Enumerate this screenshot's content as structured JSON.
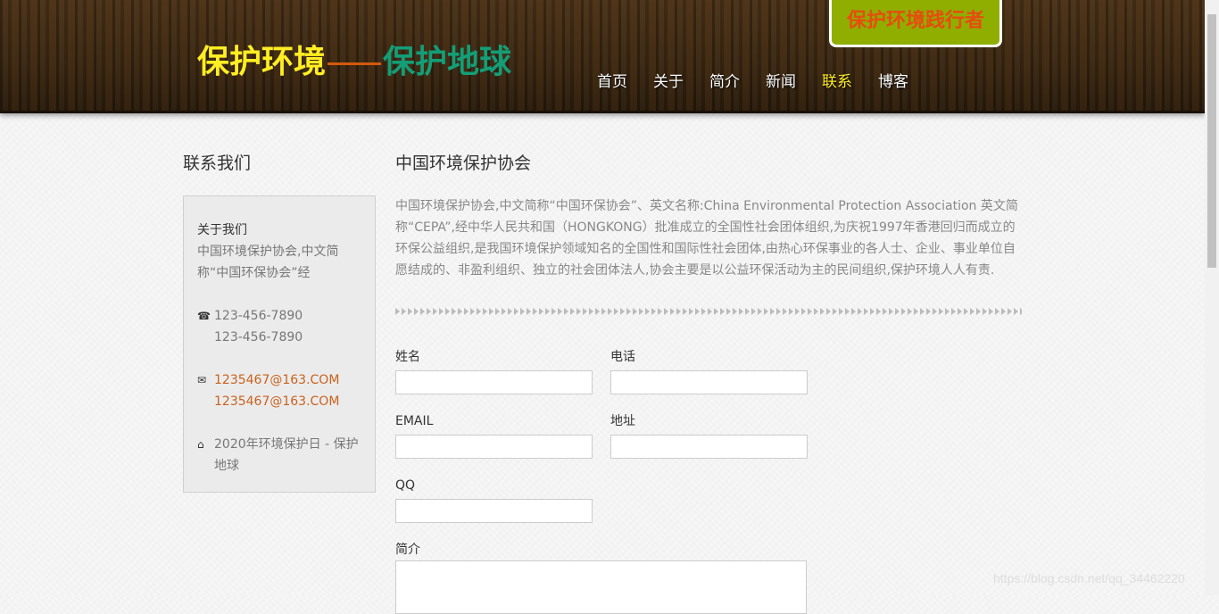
{
  "header": {
    "logo_part1": "保护环境",
    "logo_part2": "保护地球",
    "badge": "保护环境践行者",
    "nav": [
      "首页",
      "关于",
      "简介",
      "新闻",
      "联系",
      "博客"
    ],
    "active_nav": "联系",
    "colors": {
      "logo_yellow": "#ffee22",
      "logo_green": "#139e77",
      "badge_bg": "#8fae00",
      "badge_text": "#e84b0f"
    }
  },
  "sidebar": {
    "title": "联系我们",
    "about_title": "关于我们",
    "about_text": "中国环境保护协会,中文简称“中国环保协会”经",
    "phone_icon": "phone-icon",
    "phone1": "123-456-7890",
    "phone2": "123-456-7890",
    "mail_icon": "envelope-icon",
    "email1": "1235467@163.COM",
    "email2": "1235467@163.COM",
    "home_icon": "home-icon",
    "address": "2020年环境保护日 - 保护地球"
  },
  "main": {
    "title": "中国环境保护协会",
    "intro": "中国环境保护协会,中文简称“中国环保协会”、英文名称:China Environmental Protection Association 英文简称“CEPA”,经中华人民共和国（HONGKONG）批准成立的全国性社会团体组织,为庆祝1997年香港回归而成立的环保公益组织,是我国环境保护领域知名的全国性和国际性社会团体,由热心环保事业的各人士、企业、事业单位自愿结成的、非盈利组织、独立的社会团体法人,协会主要是以公益环保活动为主的民间组织,保护环境人人有责."
  },
  "form": {
    "name_label": "姓名",
    "phone_label": "电话",
    "email_label": "EMAIL",
    "address_label": "地址",
    "qq_label": "QQ",
    "intro_label": "简介",
    "name_value": "",
    "phone_value": "",
    "email_value": "",
    "address_value": "",
    "qq_value": "",
    "intro_value": ""
  },
  "watermark": "https://blog.csdn.net/qq_34462220"
}
